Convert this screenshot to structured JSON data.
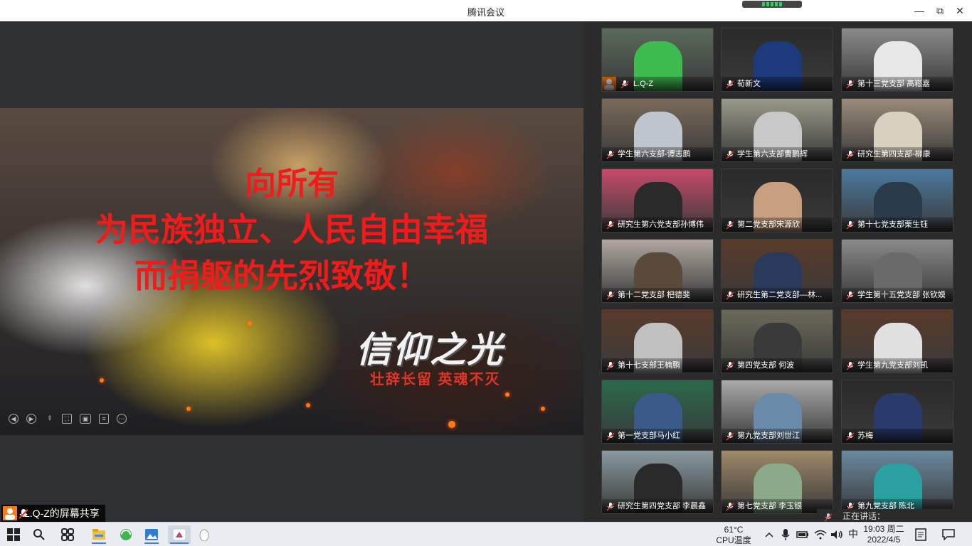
{
  "window": {
    "title": "腾讯会议"
  },
  "colors": {
    "accent_orange": "#f47b20",
    "mic_red": "#e53935",
    "slide_red": "#f21b1b",
    "network_green": "#2fcf5b"
  },
  "slide": {
    "line1": "向所有",
    "line2": "为民族独立、人民自由幸福",
    "line3": "而捐躯的先烈致敬！",
    "brand": "信仰之光",
    "subtitle": "壮辞长留  英魂不灭",
    "tools": [
      "prev-icon",
      "play-icon",
      "pen-icon",
      "fullscreen-icon",
      "camera-icon",
      "comment-icon",
      "more-icon"
    ]
  },
  "share": {
    "label": "L.Q-Z的屏幕共享"
  },
  "participants": [
    {
      "name": "L.Q-Z",
      "host": true
    },
    {
      "name": "荀新文"
    },
    {
      "name": "第十三党支部 高崧嘉"
    },
    {
      "name": "学生第六支部-谭志鹏"
    },
    {
      "name": "学生第六支部曹鹏辉"
    },
    {
      "name": "研究生第四支部-柳康"
    },
    {
      "name": "研究生第六党支部孙博伟"
    },
    {
      "name": "第二党支部宋源欣"
    },
    {
      "name": "第十七党支部栗生钰"
    },
    {
      "name": "第十二党支部 杷德斐"
    },
    {
      "name": "研究生第二党支部—林..."
    },
    {
      "name": "学生第十五党支部 张钦嫫"
    },
    {
      "name": "第十七支部王楠鹏"
    },
    {
      "name": "第四党支部 何波"
    },
    {
      "name": "学生第九党支部刘凯"
    },
    {
      "name": "第一党支部马小红"
    },
    {
      "name": "第九党支部刘世江"
    },
    {
      "name": "苏梅"
    },
    {
      "name": "研究生第四党支部 李晨鑫"
    },
    {
      "name": "第七党支部 李玉银"
    },
    {
      "name": "第九党支部 陈北"
    }
  ],
  "speaking": {
    "label": "正在讲话："
  },
  "taskbar": {
    "temp_value": "61°C",
    "temp_label": "CPU温度",
    "ime": "中",
    "time": "19:03 周二",
    "date": "2022/4/5"
  }
}
